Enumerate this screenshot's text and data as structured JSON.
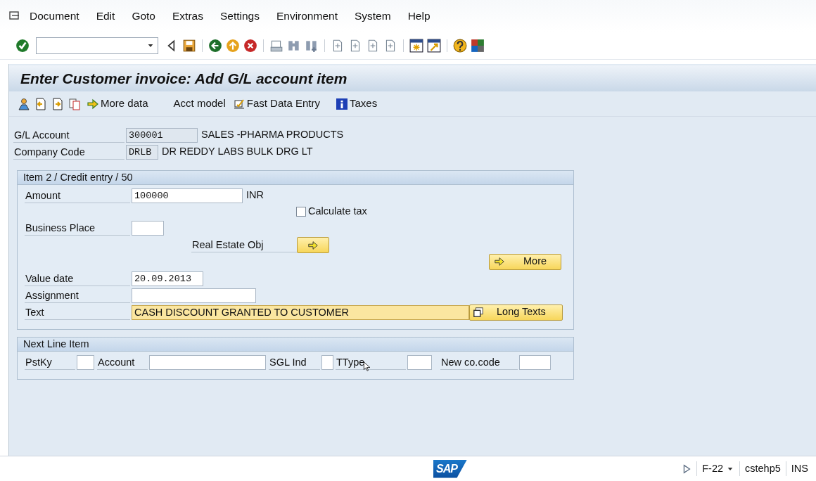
{
  "menu": [
    {
      "label": "Document"
    },
    {
      "label": "Edit"
    },
    {
      "label": "Goto"
    },
    {
      "label": "Extras"
    },
    {
      "label": "Settings"
    },
    {
      "label": "Environment"
    },
    {
      "label": "System"
    },
    {
      "label": "Help"
    }
  ],
  "title": "Enter Customer invoice: Add G/L account item",
  "app_toolbar": [
    {
      "label": "More data"
    },
    {
      "label": "Acct model"
    },
    {
      "label": "Fast Data Entry"
    },
    {
      "label": "Taxes"
    }
  ],
  "header_fields": [
    {
      "label": "G/L Account",
      "value": "300001",
      "description": "SALES -PHARMA PRODUCTS"
    },
    {
      "label": "Company Code",
      "value": "DRLB",
      "description": "DR REDDY LABS BULK DRG LT"
    }
  ],
  "item_section": {
    "title": "Item 2 / Credit entry / 50",
    "amount": {
      "label": "Amount",
      "value": "100000",
      "currency": "INR"
    },
    "calculate_tax": {
      "label": "Calculate tax",
      "checked": false
    },
    "business_place": {
      "label": "Business Place"
    },
    "real_estate_obj": {
      "label": "Real Estate Obj"
    },
    "more_button": "More",
    "value_date": {
      "label": "Value date",
      "value": "20.09.2013"
    },
    "assignment": {
      "label": "Assignment"
    },
    "text": {
      "label": "Text",
      "value": "CASH DISCOUNT GRANTED TO CUSTOMER",
      "focused": true
    },
    "long_texts_button": "Long Texts"
  },
  "next_line_item": {
    "title": "Next Line Item",
    "fields": [
      {
        "label": "PstKy"
      },
      {
        "label": "Account"
      },
      {
        "label": "SGL Ind"
      },
      {
        "label": "TType"
      },
      {
        "label": "New co.code"
      }
    ]
  },
  "status_bar": {
    "logo": "SAP",
    "transaction": "F-22",
    "server": "cstehp5",
    "mode": "INS"
  }
}
